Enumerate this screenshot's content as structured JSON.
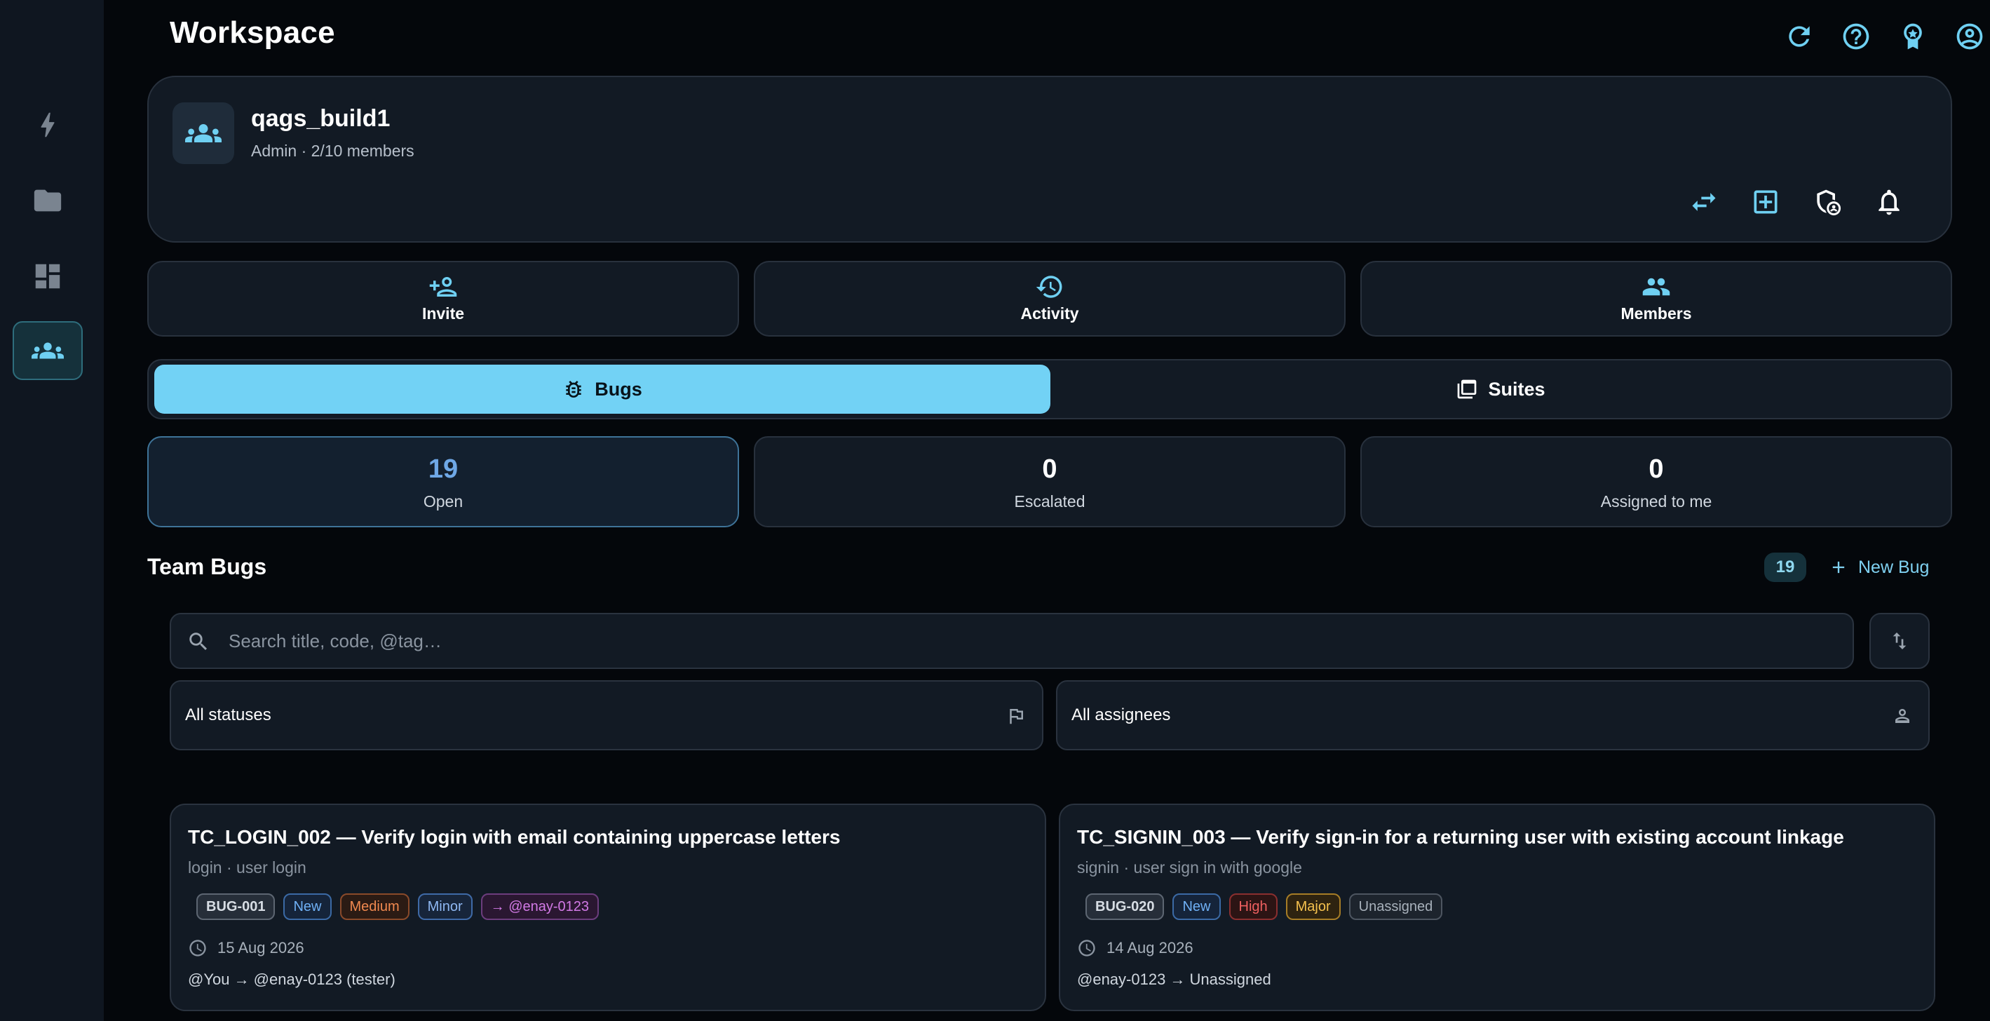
{
  "app": {
    "title": "Workspace"
  },
  "rail": {
    "items": [
      {
        "icon": "bolt-icon",
        "active": false
      },
      {
        "icon": "folder-icon",
        "active": false
      },
      {
        "icon": "dashboard-icon",
        "active": false
      },
      {
        "icon": "groups-icon",
        "active": true
      }
    ]
  },
  "topbar_icons": [
    "refresh-icon",
    "help-icon",
    "badge-star-icon",
    "account-icon"
  ],
  "workspace": {
    "name": "qags_build1",
    "subtitle": "Admin · 2/10 members",
    "actions": [
      "swap-icon",
      "add-box-icon",
      "shield-user-icon",
      "bell-icon"
    ]
  },
  "quick_actions": [
    {
      "label": "Invite",
      "icon": "person-add-icon"
    },
    {
      "label": "Activity",
      "icon": "history-icon"
    },
    {
      "label": "Members",
      "icon": "groups-icon"
    }
  ],
  "segments": {
    "bugs": "Bugs",
    "suites": "Suites",
    "active": "bugs"
  },
  "stats": [
    {
      "value": "19",
      "label": "Open",
      "active": true
    },
    {
      "value": "0",
      "label": "Escalated",
      "active": false
    },
    {
      "value": "0",
      "label": "Assigned to me",
      "active": false
    }
  ],
  "team_bugs": {
    "title": "Team Bugs",
    "count": "19",
    "new_button": "New Bug",
    "search_placeholder": "Search title, code, @tag…",
    "status_filter": "All statuses",
    "assignee_filter": "All assignees"
  },
  "bugs": [
    {
      "title": "TC_LOGIN_002 — Verify login with email containing uppercase letters",
      "sub": "login · user login",
      "code": "BUG-001",
      "status": "New",
      "priority": "Medium",
      "severity": "Minor",
      "assignee": "→ @enay-0123",
      "date": "15 Aug 2026",
      "flow": "@You → @enay-0123 (tester)"
    },
    {
      "title": "TC_SIGNIN_003 — Verify sign-in for a returning user with existing account linkage",
      "sub": "signin · user sign in with google",
      "code": "BUG-020",
      "status": "New",
      "priority": "High",
      "severity": "Major",
      "assignee": "Unassigned",
      "date": "14 Aug 2026",
      "flow": "@enay-0123 → Unassigned"
    }
  ],
  "colors": {
    "accent": "#72d2f5",
    "background": "#04070b",
    "card": "#121a24",
    "rail": "#0f1620"
  }
}
